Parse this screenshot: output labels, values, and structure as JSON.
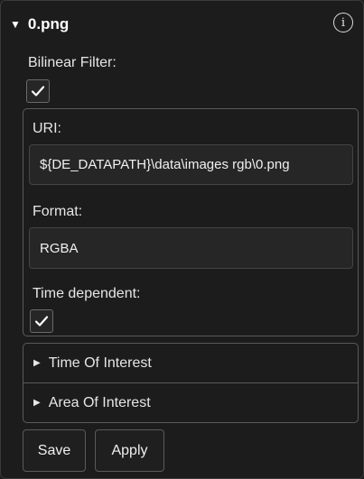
{
  "header": {
    "title": "0.png",
    "collapse_icon": "caret-down-icon",
    "info_icon": "info-icon",
    "info_glyph": "i"
  },
  "bilinear_filter": {
    "label": "Bilinear Filter:",
    "checked": true
  },
  "uri": {
    "label": "URI:",
    "value": "${DE_DATAPATH}\\data\\images rgb\\0.png"
  },
  "format": {
    "label": "Format:",
    "value": "RGBA"
  },
  "time_dependent": {
    "label": "Time dependent:",
    "checked": true
  },
  "sections": {
    "time_of_interest": "Time Of Interest",
    "area_of_interest": "Area Of Interest"
  },
  "buttons": {
    "save": "Save",
    "apply": "Apply"
  }
}
